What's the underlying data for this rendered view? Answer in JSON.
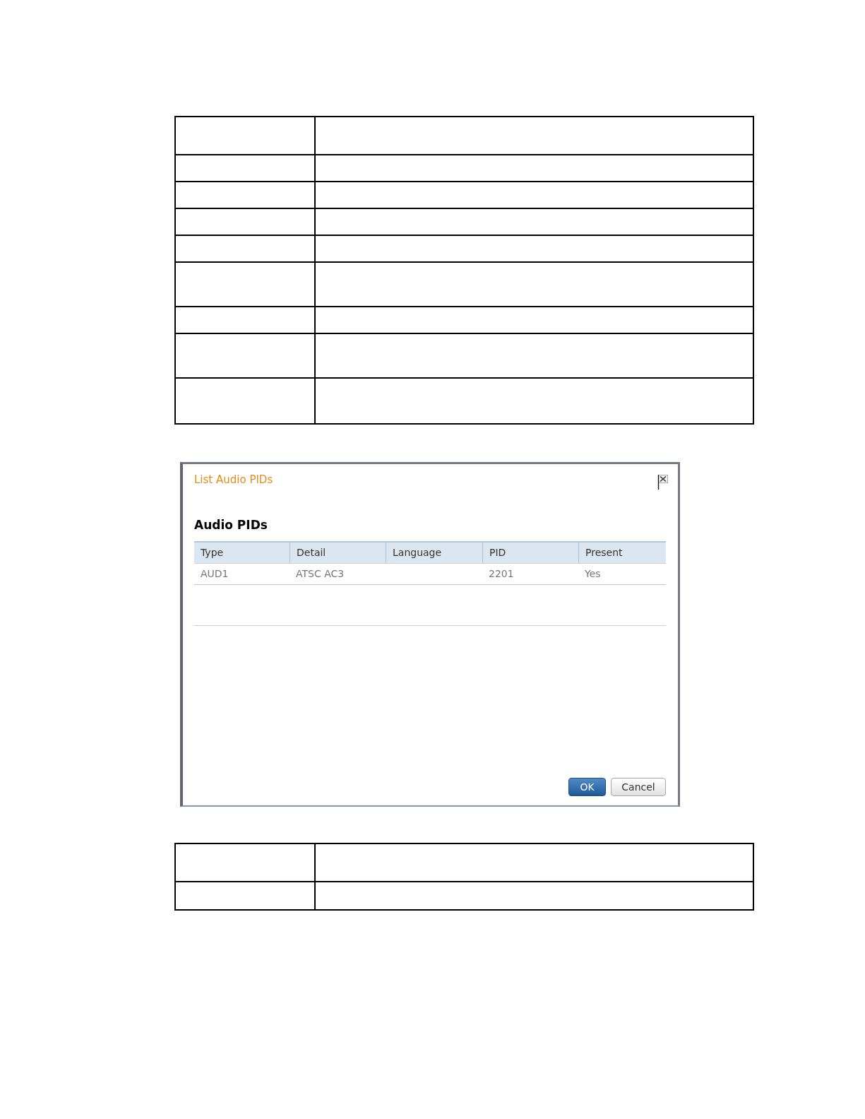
{
  "document_tables": [
    {
      "rows": [
        {
          "kind": "medium"
        },
        {
          "kind": "short"
        },
        {
          "kind": "short"
        },
        {
          "kind": "short"
        },
        {
          "kind": "short"
        },
        {
          "kind": "tall"
        },
        {
          "kind": "short"
        },
        {
          "kind": "tall"
        },
        {
          "kind": "tall"
        }
      ]
    },
    {
      "rows": [
        {
          "kind": "medium"
        },
        {
          "kind": "short"
        }
      ]
    }
  ],
  "dialog": {
    "title": "List Audio PIDs",
    "heading": "Audio PIDs",
    "table": {
      "columns": [
        "Type",
        "Detail",
        "Language",
        "PID",
        "Present"
      ],
      "rows": [
        {
          "type": "AUD1",
          "detail": "ATSC AC3",
          "pid": "2201",
          "present": "Yes"
        }
      ]
    },
    "buttons": [
      {
        "label": "OK",
        "kind": "primary"
      },
      {
        "label": "Cancel",
        "kind": "secondary"
      }
    ]
  }
}
